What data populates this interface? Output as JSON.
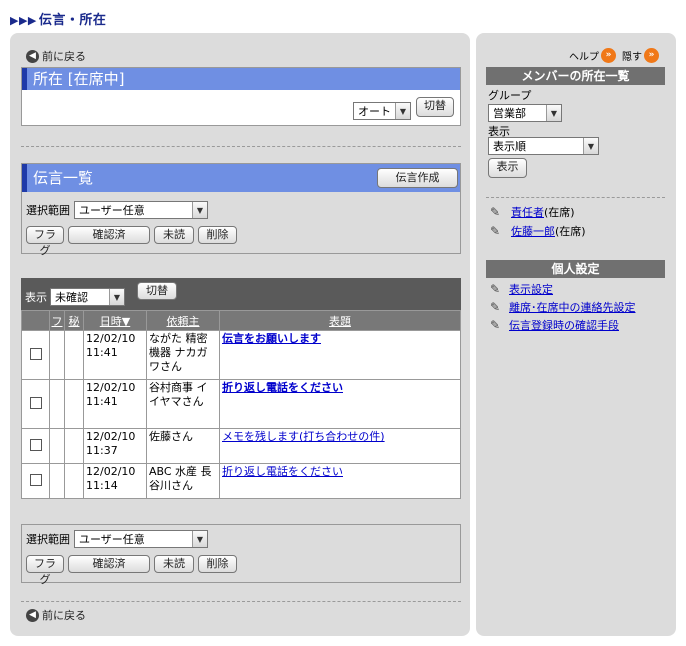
{
  "page_title": "伝言・所在",
  "back_label": "前に戻る",
  "presence": {
    "heading": "所在 [在席中]",
    "auto_select": "オート",
    "switch_label": "切替"
  },
  "messages": {
    "heading": "伝言一覧",
    "create_label": "伝言作成",
    "range_label": "選択範囲",
    "range_value": "ユーザー任意",
    "flag_label": "フラグ",
    "confirmed_label": "確認済",
    "unread_label": "未読",
    "delete_label": "削除",
    "display_label": "表示",
    "display_value": "未確認",
    "switch_label": "切替",
    "columns": {
      "flag": "フ",
      "secret": "秘",
      "datetime": "日時▼",
      "requester": "依頼主",
      "subject": "表題"
    },
    "rows": [
      {
        "date": "12/02/10",
        "time": "11:41",
        "requester": "ながた 精密機器 ナカガワさん",
        "subject": "伝言をお願いします",
        "bold": true
      },
      {
        "date": "12/02/10",
        "time": "11:41",
        "requester": "谷村商事 イイヤマさん",
        "subject": "折り返し電話をください",
        "bold": true
      },
      {
        "date": "12/02/10",
        "time": "11:37",
        "requester": "佐藤さん",
        "subject": "メモを残します(打ち合わせの件)",
        "bold": false
      },
      {
        "date": "12/02/10",
        "time": "11:14",
        "requester": "ABC 水産 長谷川さん",
        "subject": "折り返し電話をください",
        "bold": false
      }
    ]
  },
  "right": {
    "help_label": "ヘルプ",
    "hide_label": "隠す",
    "members_heading": "メンバーの所在一覧",
    "group_label": "グループ",
    "group_value": "営業部",
    "display_label": "表示",
    "display_value": "表示順",
    "display_button": "表示",
    "members": [
      {
        "name": "責任者",
        "status": "(在席)"
      },
      {
        "name": "佐藤一郎",
        "status": "(在席)"
      }
    ],
    "personal_heading": "個人設定",
    "settings": [
      "表示設定",
      "離席･在席中の連絡先設定",
      "伝言登録時の確認手段"
    ]
  },
  "colors": {
    "title": "#1a2a8c",
    "section_header": "#6f8fe3",
    "link": "#0000cc",
    "panel": "#dcdcdc"
  }
}
